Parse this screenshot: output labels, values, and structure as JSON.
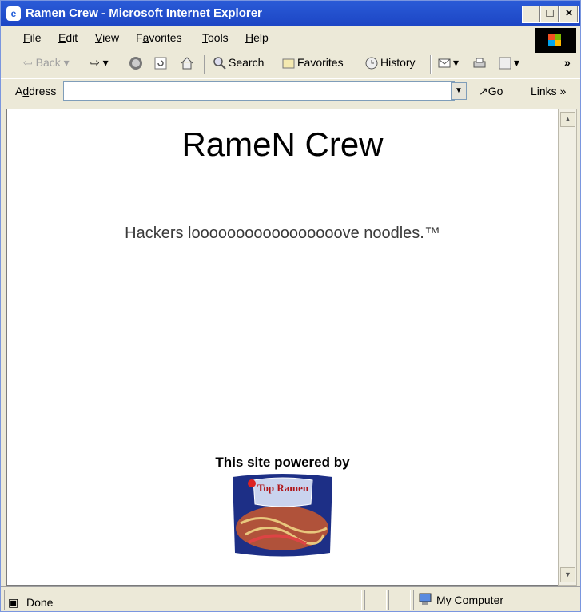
{
  "window": {
    "title": "Ramen Crew - Microsoft Internet Explorer"
  },
  "menu": [
    {
      "label": "File",
      "ul": "F",
      "rest": "ile"
    },
    {
      "label": "Edit",
      "ul": "E",
      "rest": "dit"
    },
    {
      "label": "View",
      "ul": "V",
      "rest": "iew"
    },
    {
      "label": "Favorites",
      "pre": "F",
      "ul": "a",
      "rest": "vorites"
    },
    {
      "label": "Tools",
      "ul": "T",
      "rest": "ools"
    },
    {
      "label": "Help",
      "ul": "H",
      "rest": "elp"
    }
  ],
  "toolbar": {
    "back": "Back",
    "search": "Search",
    "favorites": "Favorites",
    "history": "History"
  },
  "address": {
    "label_pre": "A",
    "label_ul": "d",
    "label_rest": "dress",
    "value": "",
    "go": "Go",
    "links": "Links"
  },
  "page": {
    "title": "RameN Crew",
    "tagline": "Hackers looooooooooooooooove noodles.™",
    "powered": "This site powered by",
    "product_brand": "Top Ramen"
  },
  "status": {
    "text": "Done",
    "zone": "My Computer"
  },
  "colors": {
    "titlebar": "#2a5bd7",
    "chrome": "#ece9d8",
    "content_bg": "#ffffff"
  }
}
